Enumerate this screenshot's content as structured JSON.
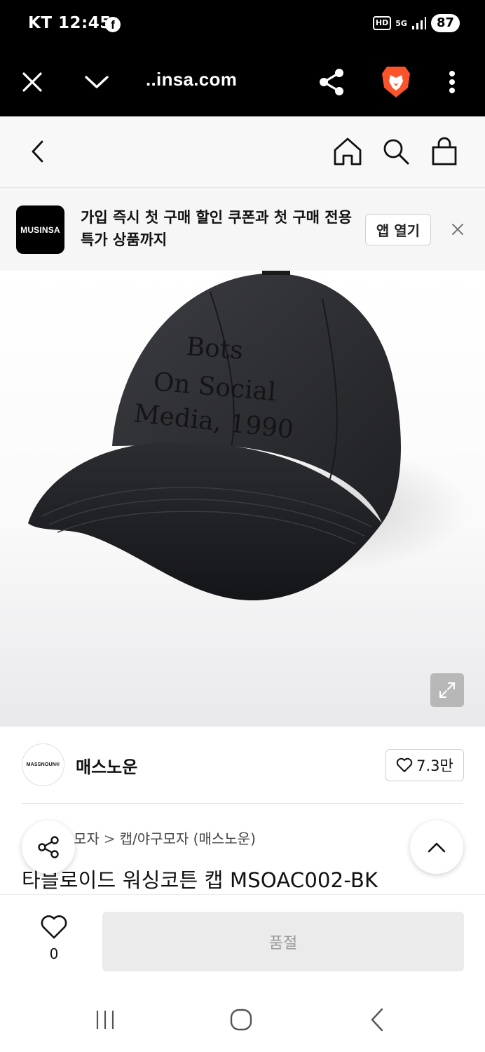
{
  "status_bar": {
    "carrier_time": "KT 12:45",
    "facebook_icon": "f",
    "hd_label": "HD",
    "network_label": "5G",
    "battery": "87"
  },
  "browser": {
    "url": "..insa.com"
  },
  "app_banner": {
    "logo_text": "MUSINSA",
    "message": "가입 즉시 첫 구매 할인 쿠폰과 첫 구매 전용 특가 상품까지",
    "open_app_label": "앱 열기"
  },
  "product_image": {
    "embroidery_text": "Bots On Social Media, 1990",
    "alt": "black baseball cap"
  },
  "brand": {
    "logo_text": "MASSNOUN®",
    "name": "매스노운",
    "likes": "7.3만"
  },
  "breadcrumb": {
    "parent": "모자",
    "separator": ">",
    "current": "캡/야구모자 (매스노운)"
  },
  "product": {
    "title": "타블로이드 워싱코튼 캡 MSOAC002-BK"
  },
  "bottom_bar": {
    "wish_count": "0",
    "soldout_label": "품절"
  },
  "colors": {
    "status_bg": "#000000",
    "brave_orange": "#fb542b",
    "soldout_bg": "#ebebeb"
  }
}
